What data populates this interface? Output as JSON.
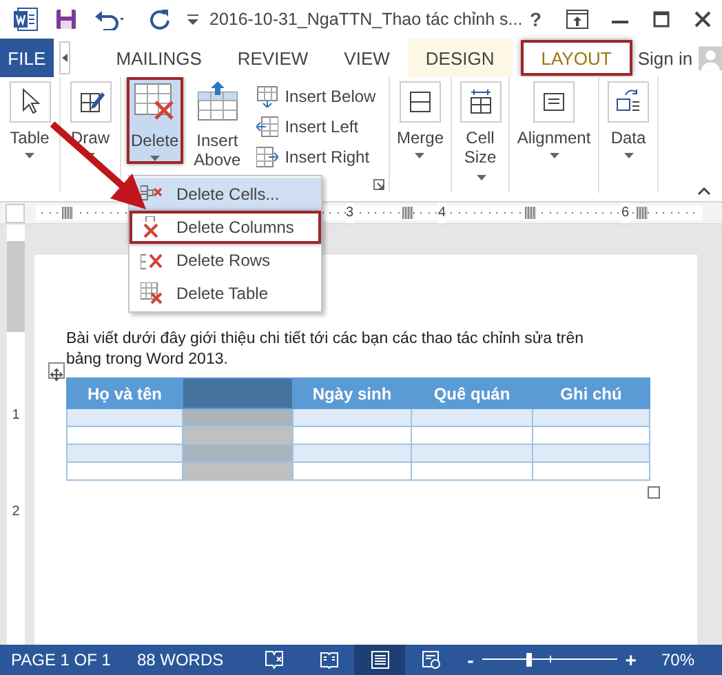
{
  "title_bar": {
    "title": "2016-10-31_NgaTTN_Thao tác chỉnh s...",
    "help": "?"
  },
  "tabs": [
    {
      "label": "FILE",
      "kind": "file",
      "selected": false,
      "annotated": false
    },
    {
      "label": "MAILINGS",
      "kind": "normal",
      "selected": false,
      "annotated": false
    },
    {
      "label": "REVIEW",
      "kind": "normal",
      "selected": false,
      "annotated": false
    },
    {
      "label": "VIEW",
      "kind": "normal",
      "selected": false,
      "annotated": false
    },
    {
      "label": "DESIGN",
      "kind": "contextual",
      "selected": false,
      "annotated": false
    },
    {
      "label": "LAYOUT",
      "kind": "contextual",
      "selected": true,
      "annotated": true
    }
  ],
  "account": {
    "label": "Sign in"
  },
  "ribbon": {
    "groups": [
      {
        "launcher": false,
        "buttons": [
          {
            "kind": "large",
            "label": "Table",
            "dropdown": true,
            "pressed": false,
            "annotated": false
          }
        ]
      },
      {
        "launcher": false,
        "buttons": [
          {
            "kind": "large",
            "label": "Draw",
            "dropdown": true,
            "pressed": false,
            "annotated": false
          }
        ]
      },
      {
        "launcher": true,
        "buttons": [
          {
            "kind": "large",
            "label": "Delete",
            "dropdown": true,
            "pressed": true,
            "annotated": true
          },
          {
            "kind": "large",
            "label": "Insert Above",
            "dropdown": false,
            "pressed": false,
            "annotated": false
          },
          {
            "kind": "stack",
            "items": [
              {
                "label": "Insert Below"
              },
              {
                "label": "Insert Left"
              },
              {
                "label": "Insert Right"
              }
            ]
          }
        ]
      },
      {
        "launcher": false,
        "buttons": [
          {
            "kind": "large",
            "label": "Merge",
            "dropdown": true,
            "pressed": false,
            "annotated": false
          }
        ]
      },
      {
        "launcher": false,
        "buttons": [
          {
            "kind": "large",
            "label": "Cell Size",
            "dropdown": true,
            "pressed": false,
            "annotated": false
          }
        ]
      },
      {
        "launcher": false,
        "buttons": [
          {
            "kind": "large",
            "label": "Alignment",
            "dropdown": true,
            "pressed": false,
            "annotated": false
          }
        ]
      },
      {
        "launcher": false,
        "buttons": [
          {
            "kind": "large",
            "label": "Data",
            "dropdown": true,
            "pressed": false,
            "annotated": false
          }
        ]
      }
    ]
  },
  "delete_menu": {
    "items": [
      {
        "label": "Delete Cells...",
        "highlighted": true,
        "annotated": false
      },
      {
        "label": "Delete Columns",
        "highlighted": false,
        "annotated": true
      },
      {
        "label": "Delete Rows",
        "highlighted": false,
        "annotated": false
      },
      {
        "label": "Delete Table",
        "highlighted": false,
        "annotated": false
      }
    ]
  },
  "ruler": {
    "top_marks": [
      "3",
      "4",
      "6"
    ],
    "left_marks": [
      "1",
      "2"
    ]
  },
  "document": {
    "paragraph": "Bài viết dưới đây giới thiệu chi tiết tới các bạn các thao tác chỉnh sửa trên bảng trong Word 2013.",
    "table": {
      "columns": [
        {
          "label": "Họ và tên",
          "selected": false
        },
        {
          "selected": true
        },
        {
          "label": "Ngày sinh",
          "selected": false
        },
        {
          "label": "Quê quán",
          "selected": false
        },
        {
          "label": "Ghi chú",
          "selected": false
        }
      ],
      "rows": [
        {
          "banded": true
        },
        {
          "banded": false
        },
        {
          "banded": true
        },
        {
          "banded": false
        }
      ]
    }
  },
  "status_bar": {
    "page": "PAGE 1 OF 1",
    "words": "88 WORDS",
    "views": [
      {
        "kind": "read",
        "selected": false
      },
      {
        "kind": "print",
        "selected": true
      },
      {
        "kind": "web",
        "selected": false
      }
    ],
    "zoom_out": "-",
    "zoom_in": "+",
    "zoom": {
      "level": 0.35
    },
    "zoom_label": "70%"
  }
}
